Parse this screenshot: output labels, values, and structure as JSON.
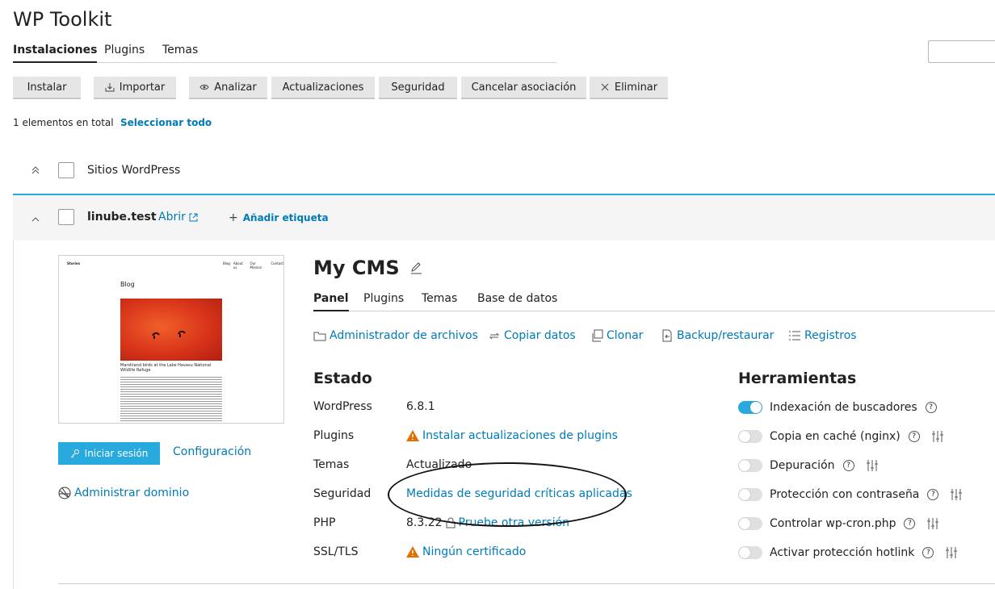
{
  "app": {
    "title": "WP Toolkit"
  },
  "tabs": [
    "Instalaciones",
    "Plugins",
    "Temas"
  ],
  "toolbar": {
    "install": "Instalar",
    "import": "Importar",
    "analyze": "Analizar",
    "updates": "Actualizaciones",
    "security": "Seguridad",
    "detach": "Cancelar asociación",
    "delete": "Eliminar"
  },
  "list": {
    "count": "1 elementos en total",
    "select_all": "Seleccionar todo"
  },
  "group": {
    "label": "Sitios WordPress"
  },
  "site": {
    "domain": "linube.test",
    "open": "Abrir",
    "add_tag": "Añadir etiqueta",
    "login": "Iniciar sesión",
    "config": "Configuración",
    "manage_domain": "Administrar dominio",
    "title": "My CMS"
  },
  "thumb": {
    "brand": "Stories",
    "nav": [
      "Blog",
      "About us",
      "Our Mission",
      "Contact"
    ],
    "heading": "Blog",
    "caption": "Marshland birds at the Lake Havasu National Wildlife Refuge"
  },
  "subtabs": [
    "Panel",
    "Plugins",
    "Temas",
    "Base de datos"
  ],
  "actions": [
    "Administrador de archivos",
    "Copiar datos",
    "Clonar",
    "Backup/restaurar",
    "Registros"
  ],
  "status": {
    "title": "Estado",
    "rows": [
      {
        "label": "WordPress",
        "value": "6.8.1"
      },
      {
        "label": "Plugins",
        "value": "Instalar actualizaciones de plugins"
      },
      {
        "label": "Temas",
        "value": "Actualizado"
      },
      {
        "label": "Seguridad",
        "value": "Medidas de seguridad críticas aplicadas"
      },
      {
        "label": "PHP",
        "value": "8.3.22",
        "link": "Pruebe otra versión"
      },
      {
        "label": "SSL/TLS",
        "value": "Ningún certificado"
      }
    ]
  },
  "tools": {
    "title": "Herramientas",
    "items": [
      {
        "label": "Indexación de buscadores",
        "on": true
      },
      {
        "label": "Copia en caché (nginx)",
        "on": false
      },
      {
        "label": "Depuración",
        "on": false
      },
      {
        "label": "Protección con contraseña",
        "on": false
      },
      {
        "label": "Controlar wp-cron.php",
        "on": false
      },
      {
        "label": "Activar protección hotlink",
        "on": false
      }
    ]
  },
  "colors": {
    "accent": "#28aade",
    "link": "#007bb8",
    "warning": "#e07000"
  },
  "icons": {
    "help": "?"
  }
}
